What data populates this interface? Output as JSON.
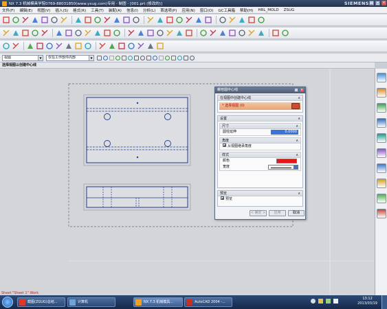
{
  "window": {
    "title": "NX 7.3 机械模具学院0769-88031850(www.yxug.com)专用 - 制图 - [001.prt (修改的)]",
    "brand": "SIEMENS",
    "min": "_",
    "max": "□",
    "close": "×"
  },
  "menu": [
    "文件(F)",
    "编辑(E)",
    "视图(V)",
    "插入(S)",
    "格式(R)",
    "工具(T)",
    "装配(A)",
    "信息(I)",
    "分析(L)",
    "首选项(P)",
    "应用(N)",
    "窗口(O)",
    "GC工具箱",
    "帮助(H)",
    "HRL_MOLD",
    "ZSUG"
  ],
  "selection_bar": {
    "filter": "视图",
    "scope": "仅在工作部件内部"
  },
  "cue_line": "选择视图以创建中心线",
  "dialog": {
    "title": "螺栓圆中心线",
    "subtitle": "在视图中创建中心线",
    "select_view": "* 选择视图 (0)",
    "settings": "设置",
    "size_label": "尺寸",
    "circle_extension": "圆柱延伸",
    "circle_extension_value": "0.0000",
    "angle_label": "角度",
    "angle_check": "从视图继承角度",
    "style_label": "样式",
    "color_label": "颜色",
    "color_value": "#e01818",
    "width_label": "宽度",
    "preview": "预览",
    "preview_check": "预览",
    "ok": "< 确定 >",
    "apply": "应用",
    "cancel": "取消"
  },
  "sheet_status": "Sheet \"Sheet 1\" Work",
  "taskbar": {
    "items": [
      "截图(ZGUG)总结...",
      "计算机",
      "NX 7.3 机械模具...",
      "AutoCAD 2004 -..."
    ],
    "time": "13:12",
    "date": "2013/03/19"
  }
}
